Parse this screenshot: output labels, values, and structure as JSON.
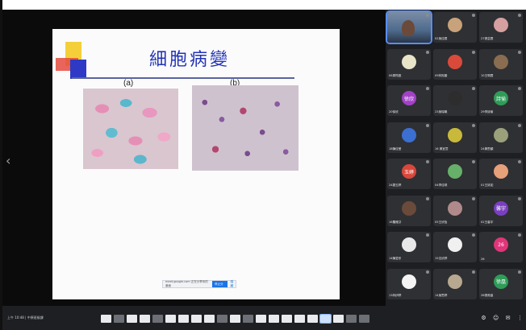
{
  "slide": {
    "title": "細胞病變",
    "fig_a_label": "(a)",
    "fig_b_label": "(b)"
  },
  "share_bar": {
    "text": "meet.google.com 正在分享你的畫面",
    "stop_label": "停止分享",
    "hide_label": "隱藏"
  },
  "meeting": {
    "label": "上午 10:48 | 中原班級課"
  },
  "participants": [
    {
      "name": "",
      "initial": "",
      "color": "#4e6a8c",
      "camera": true
    },
    {
      "name": "02吳佳蓉",
      "initial": "",
      "color": "#c8a27a"
    },
    {
      "name": "27張芸蓉",
      "initial": "",
      "color": "#d6a0a0"
    },
    {
      "name": "06周筠庭",
      "initial": "",
      "color": "#e8e4c8"
    },
    {
      "name": "09林宛蓁",
      "initial": "",
      "color": "#d94a3a"
    },
    {
      "name": "10王珮蓉",
      "initial": "",
      "color": "#8a6c50"
    },
    {
      "name": "20徐欣",
      "initial": "徐欣",
      "color": "#a142c5"
    },
    {
      "name": "23吳瑞曦",
      "initial": "",
      "color": "#2d2d2d"
    },
    {
      "name": "29李詩愉",
      "initial": "詩愉",
      "color": "#2f9c58"
    },
    {
      "name": "18陳佳瑩",
      "initial": "",
      "color": "#3b6fd1"
    },
    {
      "name": "16 黃宜萱",
      "initial": "",
      "color": "#c9b93a"
    },
    {
      "name": "24黃思穎",
      "initial": "",
      "color": "#9aa07a"
    },
    {
      "name": "24劉玉婷",
      "initial": "玉婷",
      "color": "#d8473b"
    },
    {
      "name": "04李佳琪",
      "initial": "",
      "color": "#66b06a"
    },
    {
      "name": "01王詠如",
      "initial": "",
      "color": "#e6a07a"
    },
    {
      "name": "16羅雅芬",
      "initial": "",
      "color": "#6a4a3a"
    },
    {
      "name": "05王欣怡",
      "initial": "",
      "color": "#b08a8a"
    },
    {
      "name": "02王馨宇",
      "initial": "馨宇",
      "color": "#7a3fc0"
    },
    {
      "name": "14陳昱彤",
      "initial": "",
      "color": "#e8e8e8"
    },
    {
      "name": "15沈欣婷",
      "initial": "",
      "color": "#f0f0f0"
    },
    {
      "name": "26",
      "initial": "26",
      "color": "#e0357a"
    },
    {
      "name": "13林伊婷",
      "initial": "",
      "color": "#f4f4f4"
    },
    {
      "name": "14吳思婷",
      "initial": "",
      "color": "#b8a890"
    },
    {
      "name": "28張莞凰",
      "initial": "徐凰",
      "color": "#2f9c58"
    }
  ],
  "icons": {
    "prev": "chevron-left-icon",
    "right": [
      "settings-icon",
      "people-icon",
      "chat-icon",
      "more-icon"
    ]
  },
  "colors": {
    "accent": "#1a73e8",
    "title": "#2233b8",
    "background": "#1e1f22"
  }
}
